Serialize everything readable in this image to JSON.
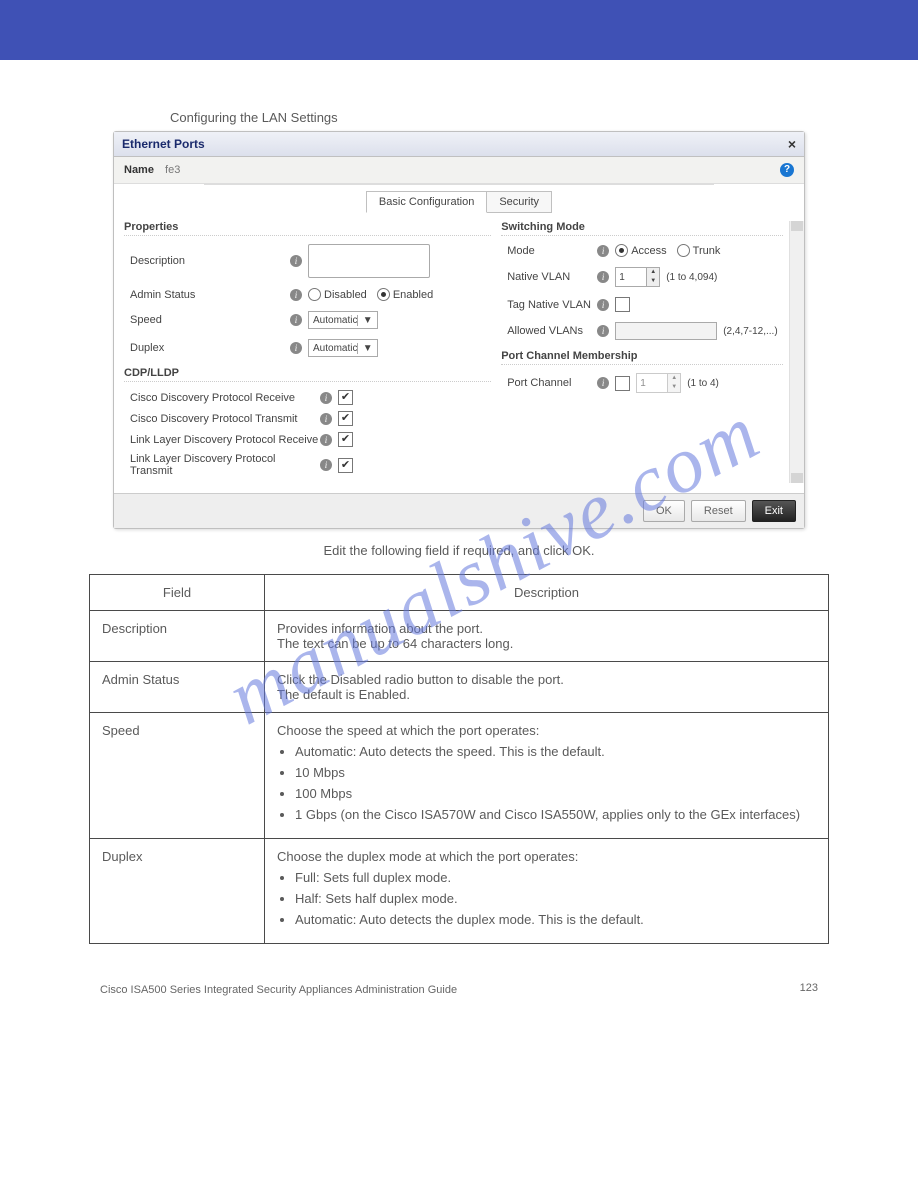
{
  "header": {
    "section_title": "Configuring the LAN Settings"
  },
  "dialog": {
    "title": "Ethernet Ports",
    "name_label": "Name",
    "name_value": "fe3",
    "tabs": [
      "Basic Configuration",
      "Security"
    ],
    "active_tab": 0,
    "properties": {
      "heading": "Properties",
      "description_label": "Description",
      "admin_status_label": "Admin Status",
      "admin_options": [
        "Disabled",
        "Enabled"
      ],
      "admin_selected": "Enabled",
      "speed_label": "Speed",
      "speed_value": "Automatic",
      "duplex_label": "Duplex",
      "duplex_value": "Automatic"
    },
    "cdp": {
      "heading": "CDP/LLDP",
      "rows": [
        {
          "label": "Cisco Discovery Protocol Receive",
          "checked": true
        },
        {
          "label": "Cisco Discovery Protocol Transmit",
          "checked": true
        },
        {
          "label": "Link Layer Discovery Protocol Receive",
          "checked": true
        },
        {
          "label": "Link Layer Discovery Protocol Transmit",
          "checked": true
        }
      ]
    },
    "switching": {
      "heading": "Switching Mode",
      "mode_label": "Mode",
      "mode_options": [
        "Access",
        "Trunk"
      ],
      "mode_selected": "Access",
      "native_vlan_label": "Native VLAN",
      "native_vlan_value": "1",
      "native_vlan_range": "(1 to 4,094)",
      "tag_native_label": "Tag Native VLAN",
      "tag_native_checked": false,
      "allowed_label": "Allowed VLANs",
      "allowed_hint": "(2,4,7-12,...)"
    },
    "port_channel": {
      "heading": "Port Channel Membership",
      "label": "Port Channel",
      "checked": false,
      "value": "1",
      "range": "(1 to 4)"
    },
    "buttons": {
      "ok": "OK",
      "reset": "Reset",
      "exit": "Exit"
    }
  },
  "doc": {
    "caption": "Edit the following field if required, and click OK.",
    "table_headers": [
      "Field",
      "Description"
    ],
    "rows": [
      {
        "field": "Description",
        "desc_lines": [
          "Provides information about the port.",
          " ",
          "The text can be up to 64 characters long."
        ]
      },
      {
        "field": "Admin Status",
        "desc_lines": [
          "Click the Disabled radio button to disable the port.",
          "The default is Enabled."
        ]
      },
      {
        "field": "Speed",
        "desc_lines": [
          "Choose the speed at which the port operates:"
        ],
        "bullets": [
          "Automatic: Auto detects the speed. This is the default.",
          "10 Mbps",
          "100 Mbps",
          "1 Gbps (on the Cisco ISA570W and Cisco ISA550W, applies only to the GEx interfaces)"
        ]
      },
      {
        "field": "Duplex",
        "desc_lines": [
          "Choose the duplex mode at which the port operates:"
        ],
        "bullets": [
          "Full: Sets full duplex mode.",
          "Half: Sets half duplex mode.",
          "Automatic: Auto detects the duplex mode. This is the default."
        ]
      }
    ]
  },
  "chart_data": {
    "type": "table",
    "title": "Ethernet Port Basic Configuration Fields",
    "columns": [
      "Field",
      "Description"
    ],
    "rows": [
      [
        "Description",
        "Provides information about the port. The text can be up to 64 characters long."
      ],
      [
        "Admin Status",
        "Click the Disabled radio button to disable the port. The default is Enabled."
      ],
      [
        "Speed",
        "Choose the speed at which the port operates: Automatic (default), 10 Mbps, 100 Mbps, 1 Gbps (ISA570W/ISA550W GEx only)."
      ],
      [
        "Duplex",
        "Choose the duplex mode at which the port operates: Full, Half, Automatic (default)."
      ]
    ]
  },
  "footer": {
    "product": "Cisco ISA500 Series Integrated Security Appliances Administration Guide",
    "page": "123"
  }
}
